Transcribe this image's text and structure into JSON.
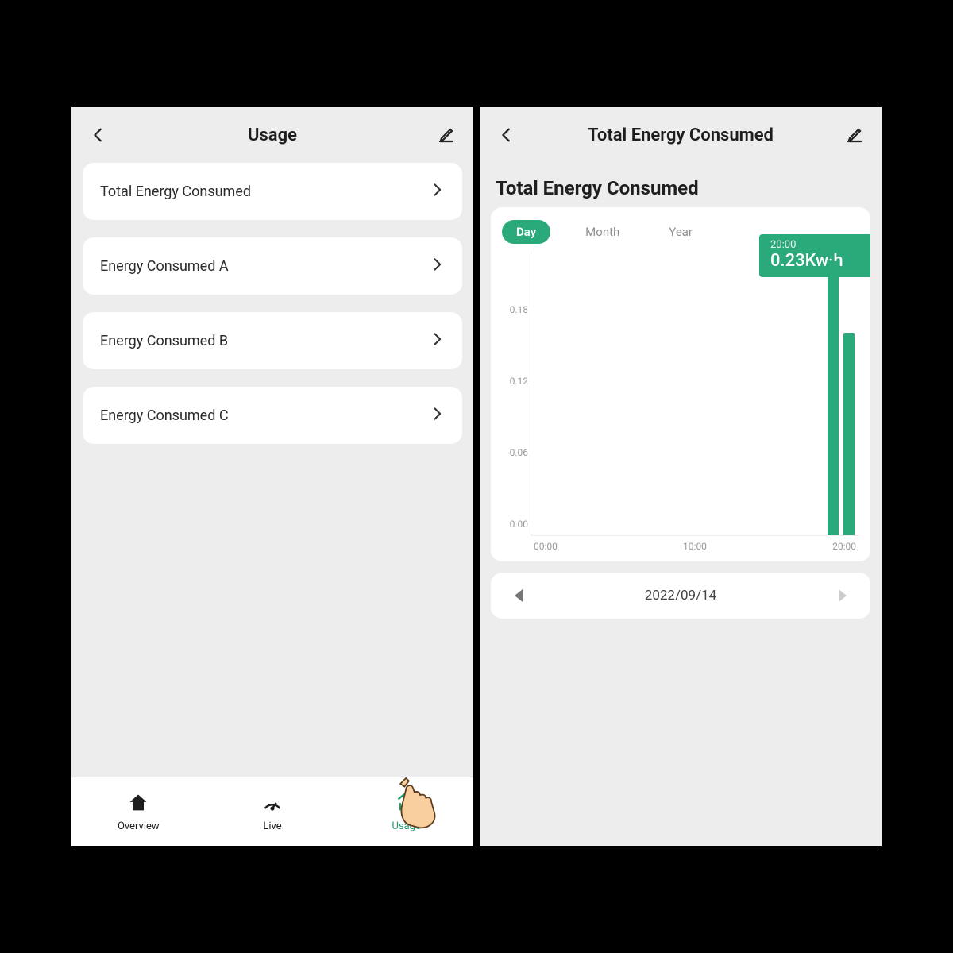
{
  "left": {
    "header": {
      "title": "Usage"
    },
    "items": [
      {
        "label": "Total Energy Consumed"
      },
      {
        "label": "Energy Consumed A"
      },
      {
        "label": "Energy Consumed B"
      },
      {
        "label": "Energy Consumed C"
      }
    ],
    "nav": {
      "overview": "Overview",
      "live": "Live",
      "usage": "Usage"
    }
  },
  "right": {
    "header": {
      "title": "Total Energy Consumed"
    },
    "page_title": "Total Energy Consumed",
    "tabs": {
      "day": "Day",
      "month": "Month",
      "year": "Year",
      "active": "day"
    },
    "tooltip": {
      "time": "20:00",
      "value": "0.23Kw·h"
    },
    "date": "2022/09/14"
  },
  "chart_data": {
    "type": "bar",
    "title": "Total Energy Consumed",
    "xlabel": "",
    "ylabel": "",
    "ylim": [
      0,
      0.24
    ],
    "y_ticks": [
      0.0,
      0.06,
      0.12,
      0.18
    ],
    "x_ticks": [
      "00:00",
      "10:00",
      "20:00"
    ],
    "categories": [
      "20:00",
      "21:00"
    ],
    "values": [
      0.23,
      0.17
    ],
    "tooltip": {
      "category": "20:00",
      "value": 0.23,
      "unit": "Kw·h"
    }
  },
  "colors": {
    "accent": "#2aa97a",
    "bg": "#ededed"
  }
}
